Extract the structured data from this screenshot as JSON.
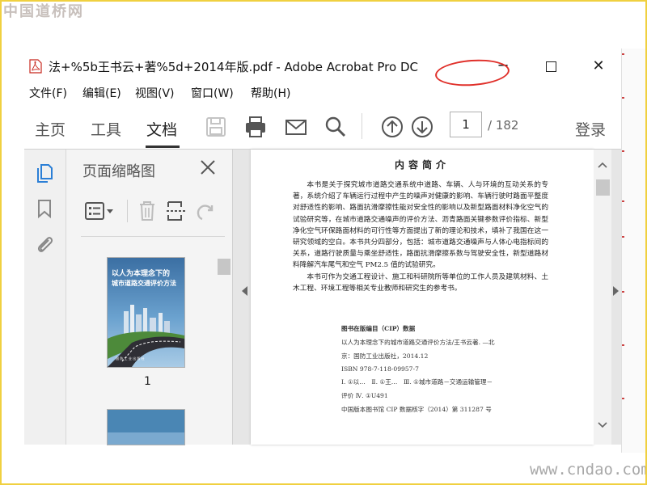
{
  "watermark": {
    "top": "中国道桥网",
    "bottom": "www.cndao.com"
  },
  "window": {
    "title": "法+%5b王书云+著%5d+2014年版.pdf - Adobe Acrobat Pro DC",
    "minimize": "─",
    "close": "✕"
  },
  "menu": [
    "文件(F)",
    "编辑(E)",
    "视图(V)",
    "窗口(W)",
    "帮助(H)"
  ],
  "toolbar": {
    "tabs": [
      "主页",
      "工具",
      "文档"
    ],
    "active_tab": "文档",
    "page_current": "1",
    "page_total": "/ 182",
    "login": "登录"
  },
  "thumbnail_panel": {
    "title": "页面缩略图",
    "thumb1": {
      "number": "1",
      "cover_title_line1": "以人为本理念下的",
      "cover_title_line2": "城市道路交通评价方法"
    }
  },
  "document": {
    "heading": "内容简介",
    "paragraphs": [
      "本书是关于探究城市道路交通系统中道路、车辆、人与环境的互动关系的专著，系统介绍了车辆运行过程中产生的噪声对健康的影响、车辆行驶时路面平整度对舒适性的影响、路面抗滑摩擦性能对安全性的影响以及新型路面材料净化空气的试验研究等，在城市道路交通噪声的评价方法、沥青路面关键参数评价指标、新型净化空气环保路面材料的可行性等方面提出了新的理论和技术，填补了我国在这一研究领域的空白。本书共分四部分，包括：城市道路交通噪声与人体心电指标间的关系，道路行驶质量与乘坐舒适性，路面抗滑摩擦系数与驾驶安全性，新型道路材料降解汽车尾气和空气 PM2.5 值的试验研究。",
      "本书可作为交通工程设计、施工和科研院所等单位的工作人员及建筑材料、土木工程、环境工程等相关专业教师和研究生的参考书。"
    ],
    "cip": [
      "图书在版编目（CIP）数据",
      "以人为本理念下的城市道路交通评价方法/王书云著. —北",
      "京：国防工业出版社，2014.12",
      "ISBN 978-7-118-09957-7",
      "Ⅰ. ①以…　Ⅱ. ①王…　Ⅲ. ①城市道路－交通运输管理－",
      "评价 Ⅳ. ①U491",
      "中国版本图书馆 CIP 数据核字（2014）第 311287 号"
    ]
  },
  "colors": {
    "highlight": "#e0302a",
    "frame": "#f0d040",
    "cover": "#3d78a8"
  }
}
